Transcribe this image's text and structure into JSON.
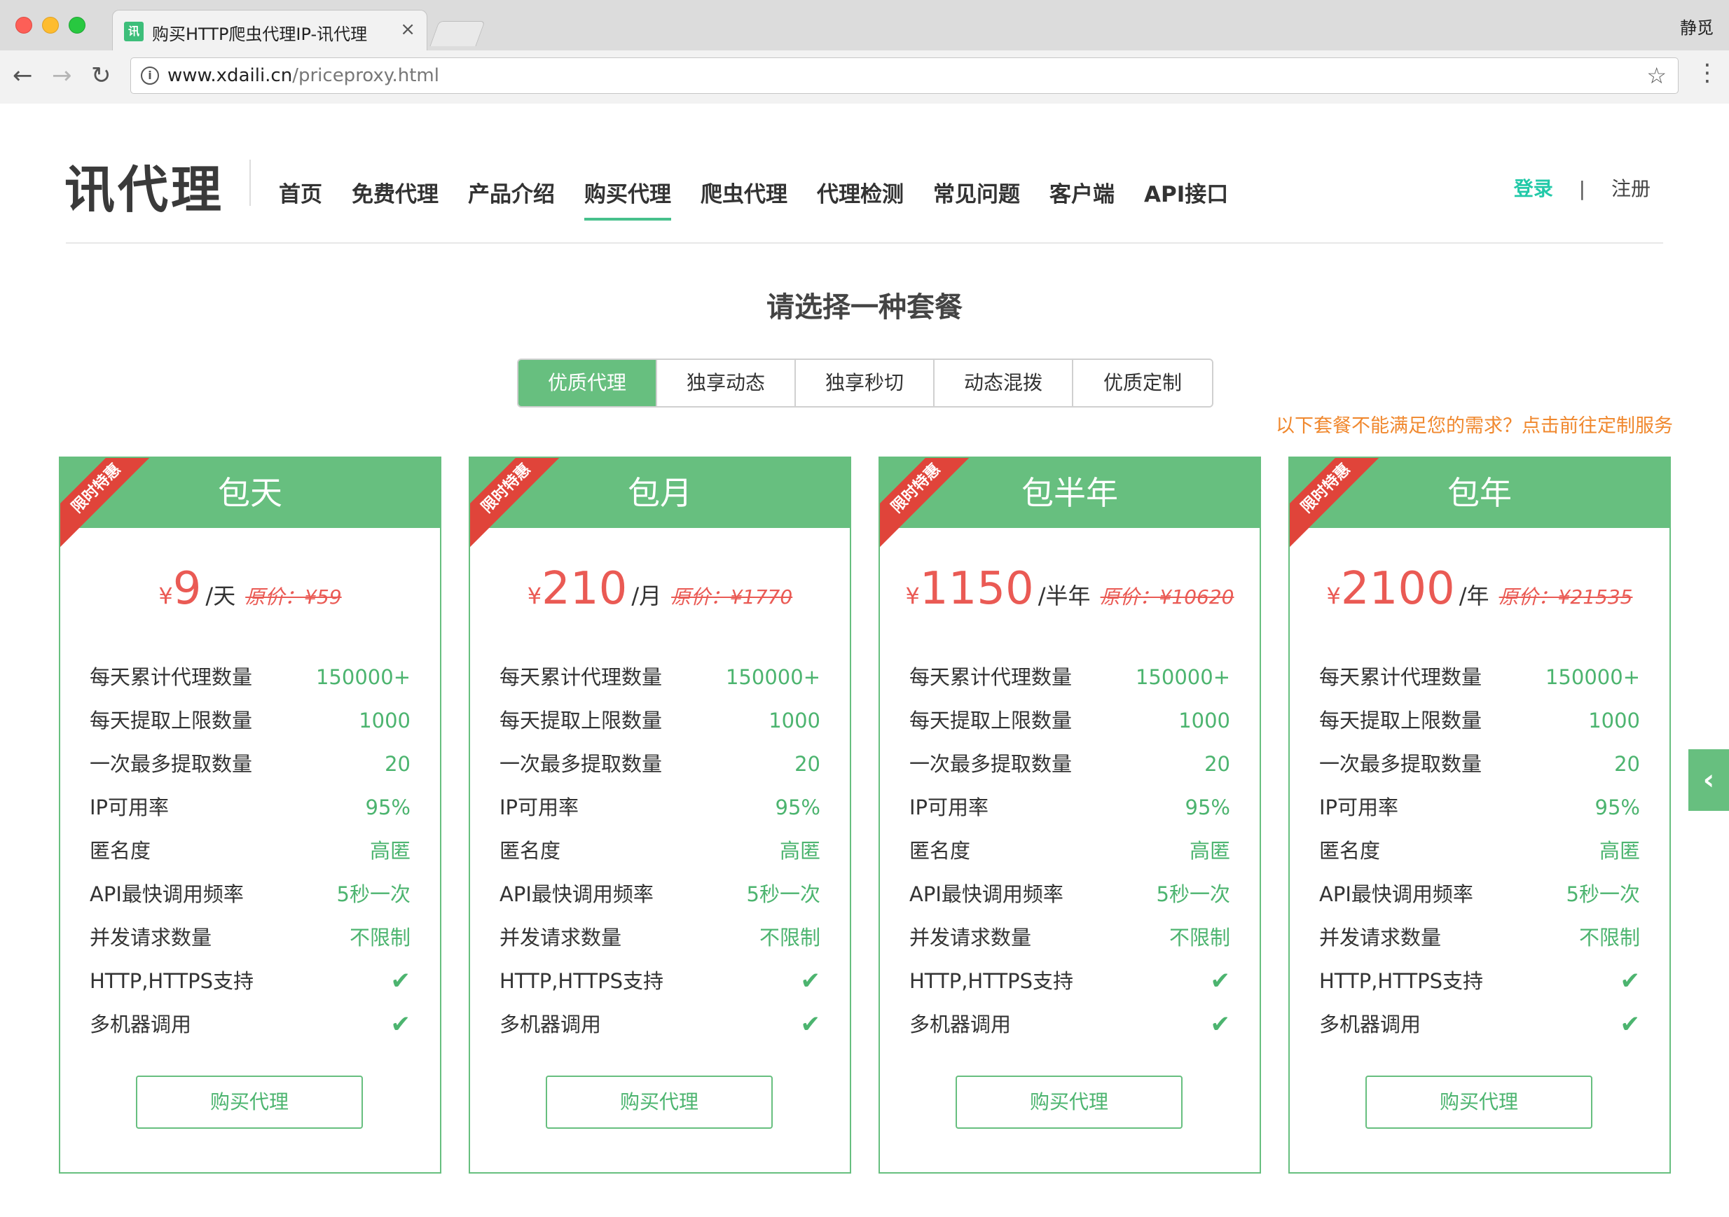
{
  "browser": {
    "tab_title": "购买HTTP爬虫代理IP-讯代理",
    "tab_close": "×",
    "favicon_text": "讯",
    "profile_name": "静觅",
    "url_host": "www.xdaili.cn",
    "url_path": "/priceproxy.html"
  },
  "header": {
    "logo": "讯代理",
    "nav": [
      "首页",
      "免费代理",
      "产品介绍",
      "购买代理",
      "爬虫代理",
      "代理检测",
      "常见问题",
      "客户端",
      "API接口"
    ],
    "active_nav": "购买代理",
    "login": "登录",
    "separator": "|",
    "register": "注册"
  },
  "section_title": "请选择一种套餐",
  "plan_tabs": [
    "优质代理",
    "独享动态",
    "独享秒切",
    "动态混拨",
    "优质定制"
  ],
  "active_plan_tab": "优质代理",
  "custom_link": "以下套餐不能满足您的需求？点击前往定制服务",
  "cards": [
    {
      "title": "包天",
      "ribbon": "限时特惠",
      "currency": "¥",
      "price": "9",
      "unit": "/天",
      "original": "原价：¥59",
      "values": [
        "150000+",
        "1000",
        "20",
        "95%",
        "高匿",
        "5秒一次",
        "不限制"
      ],
      "button": "购买代理"
    },
    {
      "title": "包月",
      "ribbon": "限时特惠",
      "currency": "¥",
      "price": "210",
      "unit": "/月",
      "original": "原价：¥1770",
      "values": [
        "150000+",
        "1000",
        "20",
        "95%",
        "高匿",
        "5秒一次",
        "不限制"
      ],
      "button": "购买代理"
    },
    {
      "title": "包半年",
      "ribbon": "限时特惠",
      "currency": "¥",
      "price": "1150",
      "unit": "/半年",
      "original": "原价：¥10620",
      "values": [
        "150000+",
        "1000",
        "20",
        "95%",
        "高匿",
        "5秒一次",
        "不限制"
      ],
      "button": "购买代理"
    },
    {
      "title": "包年",
      "ribbon": "限时特惠",
      "currency": "¥",
      "price": "2100",
      "unit": "/年",
      "original": "原价：¥21535",
      "values": [
        "150000+",
        "1000",
        "20",
        "95%",
        "高匿",
        "5秒一次",
        "不限制"
      ],
      "button": "购买代理"
    }
  ],
  "feature_names": [
    "每天累计代理数量",
    "每天提取上限数量",
    "一次最多提取数量",
    "IP可用率",
    "匿名度",
    "API最快调用频率",
    "并发请求数量",
    "HTTP,HTTPS支持",
    "多机器调用"
  ],
  "check_symbol": "✔",
  "icons": {
    "back": "arrow-left-icon",
    "forward": "arrow-right-icon",
    "reload": "reload-icon",
    "info": "info-icon",
    "star": "star-icon",
    "menu": "more-vert-icon",
    "side": "chevron-left-icon"
  },
  "colors": {
    "accent_green": "#67bf7f",
    "price_red": "#ea5a54",
    "orange_link": "#f0882e",
    "login_teal": "#22c9a8"
  }
}
